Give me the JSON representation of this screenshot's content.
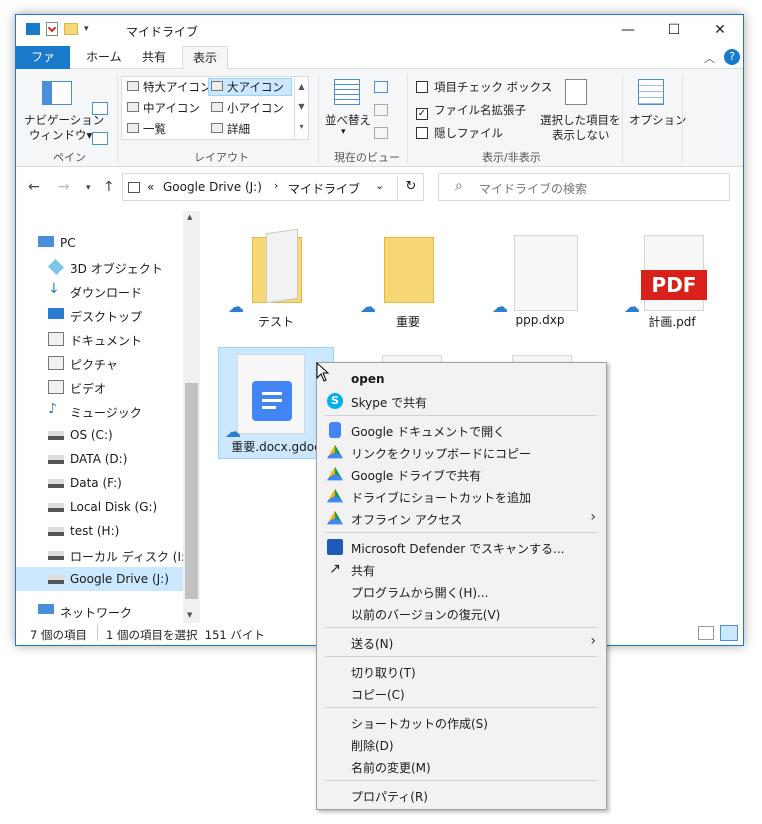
{
  "window": {
    "title": "マイドライブ",
    "controls": {
      "minimize": "—",
      "maximize": "☐",
      "close": "✕"
    }
  },
  "ribbon": {
    "tabs": [
      "ファイル",
      "ホーム",
      "共有",
      "表示"
    ],
    "active_tab": "表示",
    "panes": {
      "nav_pane_line1": "ナビゲーション",
      "nav_pane_line2": "ウィンドウ▾",
      "group_label": "ペイン"
    },
    "layout": {
      "items": [
        "特大アイコン",
        "大アイコン",
        "中アイコン",
        "小アイコン",
        "一覧",
        "詳細"
      ],
      "selected": "大アイコン",
      "group_label": "レイアウト"
    },
    "current_view": {
      "sort_label": "並べ替え",
      "group_label": "現在のビュー"
    },
    "show_hide": {
      "checkboxes": [
        {
          "label": "項目チェック ボックス",
          "checked": false
        },
        {
          "label": "ファイル名拡張子",
          "checked": true
        },
        {
          "label": "隠しファイル",
          "checked": false
        }
      ],
      "hide_selected_line1": "選択した項目を",
      "hide_selected_line2": "表示しない",
      "group_label": "表示/非表示"
    },
    "options_label": "オプション"
  },
  "address": {
    "chevrons": "«",
    "path": [
      "Google Drive (J:)",
      "マイドライブ"
    ],
    "search_placeholder": "マイドライブの検索"
  },
  "sidebar": {
    "items": [
      {
        "label": "PC",
        "icon": "pc-icon"
      },
      {
        "label": "3D オブジェクト",
        "icon": "3d-objects-icon"
      },
      {
        "label": "ダウンロード",
        "icon": "download-icon"
      },
      {
        "label": "デスクトップ",
        "icon": "desktop-icon"
      },
      {
        "label": "ドキュメント",
        "icon": "documents-icon"
      },
      {
        "label": "ピクチャ",
        "icon": "pictures-icon"
      },
      {
        "label": "ビデオ",
        "icon": "video-icon"
      },
      {
        "label": "ミュージック",
        "icon": "music-icon"
      },
      {
        "label": "OS (C:)",
        "icon": "drive-icon"
      },
      {
        "label": "DATA (D:)",
        "icon": "drive-icon"
      },
      {
        "label": "Data (F:)",
        "icon": "drive-icon"
      },
      {
        "label": "Local Disk (G:)",
        "icon": "drive-icon"
      },
      {
        "label": "test (H:)",
        "icon": "drive-icon"
      },
      {
        "label": "ローカル ディスク (I:)",
        "icon": "drive-icon"
      },
      {
        "label": "Google Drive (J:)",
        "icon": "drive-icon"
      },
      {
        "label": "ネットワーク",
        "icon": "network-icon"
      }
    ],
    "selected": "Google Drive (J:)"
  },
  "files": [
    {
      "name": "テスト",
      "type": "folder-with-doc"
    },
    {
      "name": "重要",
      "type": "folder"
    },
    {
      "name": "ppp.dxp",
      "type": "blank"
    },
    {
      "name": "計画.pdf",
      "type": "pdf",
      "badge": "PDF"
    },
    {
      "name": "重要.docx.gdoc",
      "type": "gdoc",
      "selected": true
    },
    {
      "name": "",
      "type": "blank"
    },
    {
      "name": "",
      "type": "blank"
    }
  ],
  "status": {
    "items_count": "7 個の項目",
    "selection": "1 個の項目を選択  151 バイト"
  },
  "context_menu": {
    "items": [
      {
        "label": "open",
        "bold": true,
        "icon": ""
      },
      {
        "label": "Skype で共有",
        "icon": "skype-icon"
      },
      {
        "sep": true
      },
      {
        "label": "Google ドキュメントで開く",
        "icon": "google-docs-icon"
      },
      {
        "label": "リンクをクリップボードにコピー",
        "icon": "google-drive-icon"
      },
      {
        "label": "Google ドライブで共有",
        "icon": "google-drive-icon"
      },
      {
        "label": "ドライブにショートカットを追加",
        "icon": "google-drive-icon"
      },
      {
        "label": "オフライン アクセス",
        "icon": "google-drive-icon",
        "submenu": true
      },
      {
        "sep": true
      },
      {
        "label": "Microsoft Defender でスキャンする...",
        "icon": "defender-icon"
      },
      {
        "label": "共有",
        "icon": "share-icon"
      },
      {
        "label": "プログラムから開く(H)...",
        "icon": ""
      },
      {
        "label": "以前のバージョンの復元(V)",
        "icon": ""
      },
      {
        "sep": true
      },
      {
        "label": "送る(N)",
        "icon": "",
        "submenu": true
      },
      {
        "sep": true
      },
      {
        "label": "切り取り(T)",
        "icon": ""
      },
      {
        "label": "コピー(C)",
        "icon": ""
      },
      {
        "sep": true
      },
      {
        "label": "ショートカットの作成(S)",
        "icon": ""
      },
      {
        "label": "削除(D)",
        "icon": ""
      },
      {
        "label": "名前の変更(M)",
        "icon": ""
      },
      {
        "sep": true
      },
      {
        "label": "プロパティ(R)",
        "icon": ""
      }
    ]
  },
  "colors": {
    "accent": "#1979ca",
    "selection": "#cce8ff",
    "folder": "#f8d775",
    "pdf_red": "#d9211c",
    "gdoc_blue": "#4285f4"
  }
}
